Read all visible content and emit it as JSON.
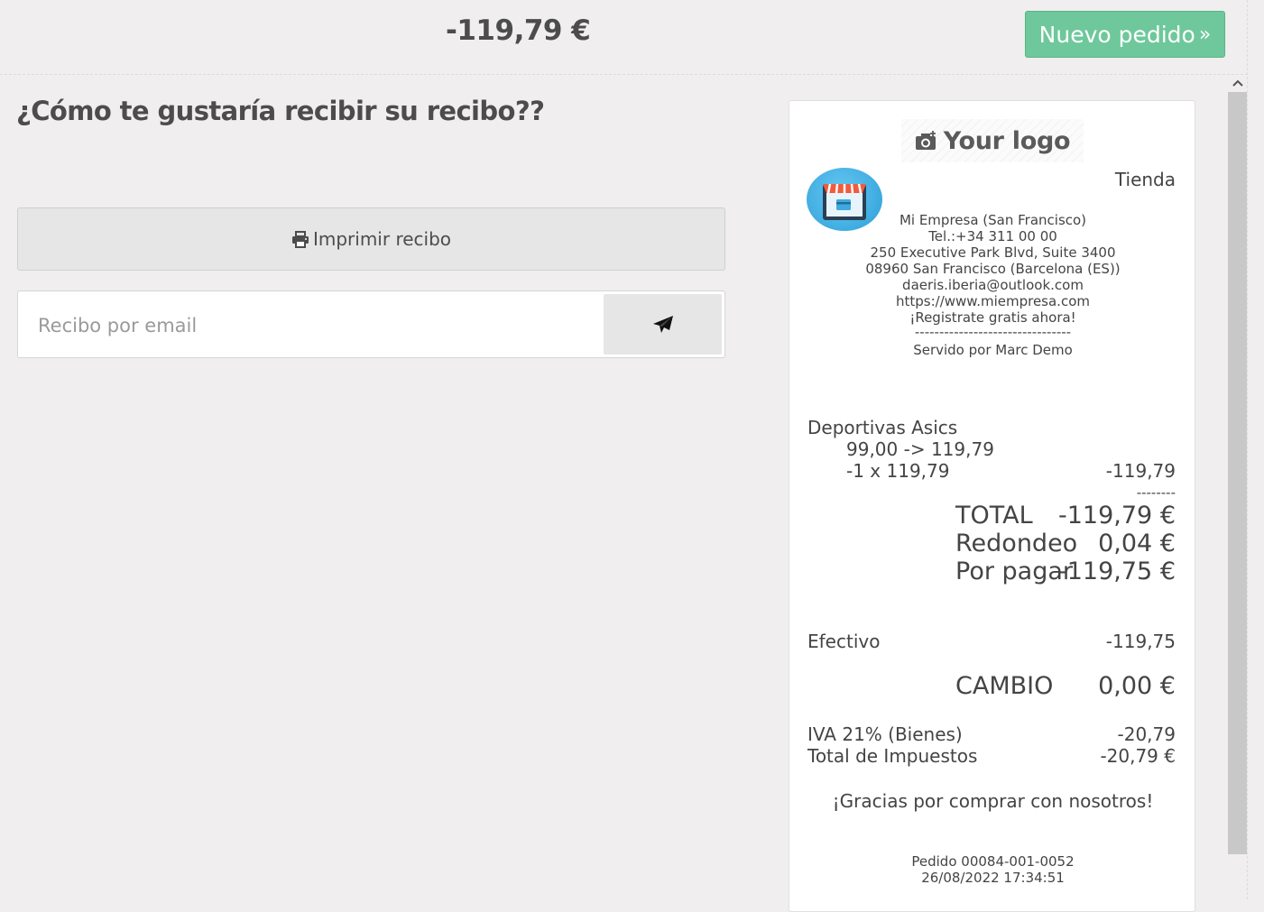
{
  "header": {
    "amount": "-119,79 €",
    "new_order_label": "Nuevo pedido",
    "new_order_icon": "double-chevron-right-icon"
  },
  "main": {
    "question": "¿Cómo te gustaría recibir su recibo??",
    "print_label": "Imprimir recibo",
    "print_icon": "printer-icon",
    "email_placeholder": "Recibo por email",
    "send_icon": "paper-plane-icon"
  },
  "receipt": {
    "logo_text": "Your logo",
    "store_label": "Tienda",
    "company_lines": [
      "Mi Empresa (San Francisco)",
      "Tel.:+34 311 00 00",
      "250 Executive Park Blvd, Suite 3400",
      "08960 San Francisco (Barcelona (ES))",
      "daeris.iberia@outlook.com",
      "https://www.miempresa.com",
      "¡Registrate gratis ahora!",
      "--------------------------------",
      "Servido por Marc Demo"
    ],
    "item": {
      "name": "Deportivas Asics",
      "price_change": "99,00 -> 119,79",
      "qty_line": "-1 x 119,79",
      "line_total": "-119,79",
      "separator": "--------"
    },
    "totals": {
      "total_label": "TOTAL",
      "total_value": "-119,79 €",
      "rounding_label": "Redondeo",
      "rounding_value": "0,04 €",
      "to_pay_label": "Por pagar",
      "to_pay_value": "-119,75 €"
    },
    "payment": {
      "method": "Efectivo",
      "amount": "-119,75"
    },
    "change": {
      "label": "CAMBIO",
      "value": "0,00 €"
    },
    "taxes": {
      "vat_label": "IVA 21% (Bienes)",
      "vat_value": "-20,79",
      "total_tax_label": "Total de Impuestos",
      "total_tax_value": "-20,79 €"
    },
    "thanks": "¡Gracias por comprar con nosotros!",
    "order_ref": "Pedido 00084-001-0052",
    "datetime": "26/08/2022 17:34:51"
  },
  "colors": {
    "accent": "#6ec89b",
    "background": "#f0eeee"
  }
}
